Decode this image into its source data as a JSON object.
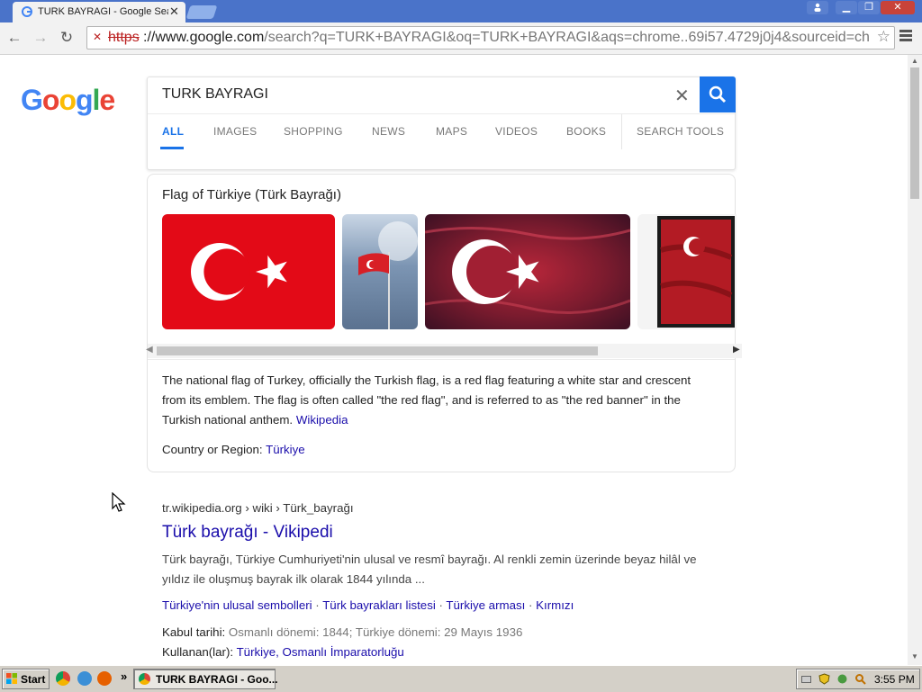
{
  "browser": {
    "tab_title": "TURK BAYRAGI - Google Search",
    "url_scheme": "https",
    "url_host": "://www.google.com",
    "url_rest": "/search?q=TURK+BAYRAGI&oq=TURK+BAYRAGI&aqs=chrome..69i57.4729j0j4&sourceid=chrome"
  },
  "search": {
    "logo": [
      "G",
      "o",
      "o",
      "g",
      "l",
      "e"
    ],
    "logo_colors": [
      "#4285f4",
      "#ea4335",
      "#fbbc05",
      "#4285f4",
      "#34a853",
      "#ea4335"
    ],
    "query": "TURK BAYRAGI",
    "tabs": [
      "ALL",
      "IMAGES",
      "SHOPPING",
      "NEWS",
      "MAPS",
      "VIDEOS",
      "BOOKS",
      "SEARCH TOOLS"
    ],
    "active_tab": "ALL"
  },
  "knowledge": {
    "title": "Flag of Türkiye (Türk Bayrağı)",
    "description": "The national flag of Turkey, officially the Turkish flag, is a red flag featuring a white star and crescent from its emblem. The flag is often called \"the red flag\", and is referred to as \"the red banner\" in the Turkish national anthem.",
    "description_link": "Wikipedia",
    "country_label": "Country or Region:",
    "country_value": "Türkiye",
    "flag_color": "#e30a17"
  },
  "result": {
    "cite": "tr.wikipedia.org › wiki › Türk_bayrağı",
    "title": "Türk bayrağı - Vikipedi",
    "snippet": "Türk bayrağı, Türkiye Cumhuriyeti'nin ulusal ve resmî bayrağı. Al renkli zemin üzerinde beyaz hilâl ve yıldız ile oluşmuş bayrak ilk olarak 1844 yılında ...",
    "links": [
      "Türkiye'nin ulusal sembolleri",
      "Türk bayrakları listesi",
      "Türkiye arması",
      "Kırmızı"
    ],
    "kabul_label": "Kabul tarihi:",
    "kabul_value": "Osmanlı dönemi: 1844; Türkiye dönemi: 29 Mayıs 1936",
    "kullanan_label": "Kullanan(lar):",
    "kullanan_value": "Türkiye, Osmanlı İmparatorluğu"
  },
  "taskbar": {
    "start_label": "Start",
    "task_label": "TURK BAYRAGI - Goo...",
    "clock": "3:55 PM",
    "more": "»"
  }
}
